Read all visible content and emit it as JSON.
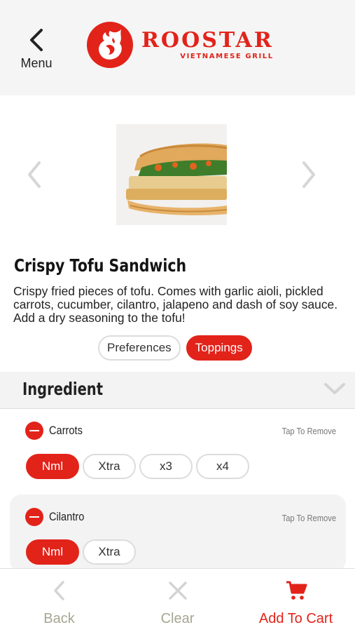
{
  "header": {
    "back_label": "Menu",
    "brand_name": "ROOSTAR",
    "brand_tagline": "VIETNAMESE GRILL"
  },
  "product": {
    "name": "Crispy Tofu Sandwich",
    "description": "Crispy fried pieces of tofu. Comes with garlic aioli, pickled carrots, cucumber, cilantro, jalapeno and dash of soy sauce. Add a dry seasoning to the tofu!"
  },
  "tabs": [
    {
      "label": "Preferences",
      "active": false
    },
    {
      "label": "Toppings",
      "active": true
    }
  ],
  "section": {
    "title": "Ingredient"
  },
  "ingredients": [
    {
      "name": "Carrots",
      "action": "Tap To Remove",
      "options": [
        "Nml",
        "Xtra",
        "x3",
        "x4"
      ],
      "selected": "Nml"
    },
    {
      "name": "Cilantro",
      "action": "Tap To Remove",
      "options": [
        "Nml",
        "Xtra"
      ],
      "selected": "Nml"
    }
  ],
  "footer": {
    "back_label": "Back",
    "clear_label": "Clear",
    "cart_label": "Add To Cart"
  },
  "colors": {
    "accent": "#e2231a",
    "footer_muted": "#a6a692",
    "header_bg": "#f5f5f5"
  },
  "icons": [
    "back-chevron-icon",
    "rooster-logo-icon",
    "chevron-left-icon",
    "chevron-right-icon",
    "chevron-down-icon",
    "minus-circle-icon",
    "close-icon",
    "cart-icon"
  ]
}
